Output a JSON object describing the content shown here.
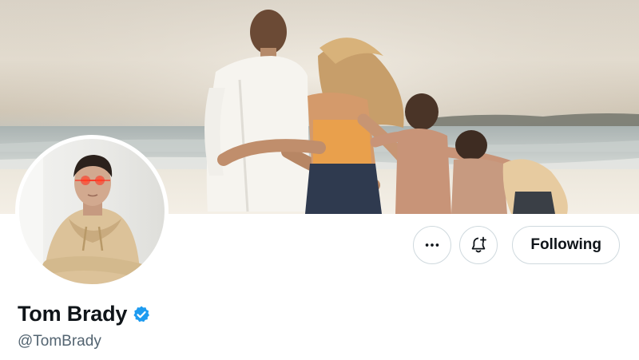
{
  "profile": {
    "display_name": "Tom Brady",
    "handle": "@TomBrady",
    "verified": true,
    "verified_icon": "verified-badge-icon"
  },
  "actions": {
    "more_icon": "more-horizontal-icon",
    "notify_icon": "bell-plus-icon",
    "following_label": "Following"
  },
  "colors": {
    "verified_blue": "#1d9bf0",
    "text_primary": "#0f1419",
    "text_secondary": "#536471",
    "border": "#cfd9de",
    "laser_red": "#ff2a1a"
  }
}
